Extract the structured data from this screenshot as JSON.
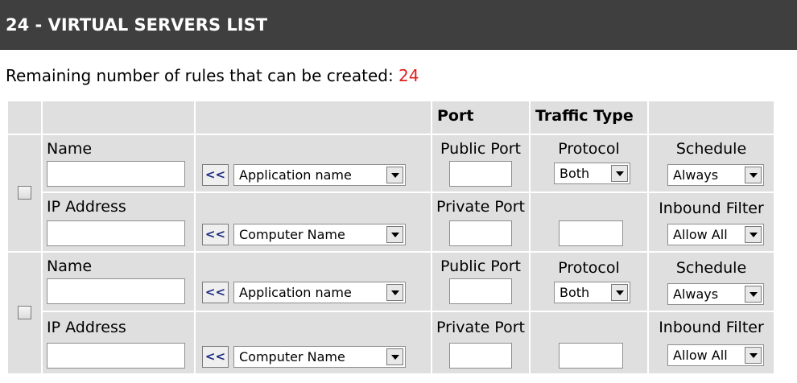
{
  "section": {
    "title": "24 - VIRTUAL SERVERS LIST"
  },
  "remaining": {
    "label": "Remaining number of rules that can be created:",
    "count": "24"
  },
  "table": {
    "headers": {
      "port": "Port",
      "traffic_type": "Traffic Type"
    },
    "rules": [
      {
        "name_label": "Name",
        "name_value": "",
        "app_button": "<<",
        "app_select": "Application name",
        "public_port_label": "Public Port",
        "public_port_value": "",
        "protocol_label": "Protocol",
        "protocol_select": "Both",
        "schedule_label": "Schedule",
        "schedule_select": "Always",
        "ip_label": "IP Address",
        "ip_value": "",
        "computer_button": "<<",
        "computer_select": "Computer Name",
        "private_port_label": "Private Port",
        "private_port_value": "",
        "protocol_number_value": "",
        "inbound_label": "Inbound Filter",
        "inbound_select": "Allow All"
      },
      {
        "name_label": "Name",
        "name_value": "",
        "app_button": "<<",
        "app_select": "Application name",
        "public_port_label": "Public Port",
        "public_port_value": "",
        "protocol_label": "Protocol",
        "protocol_select": "Both",
        "schedule_label": "Schedule",
        "schedule_select": "Always",
        "ip_label": "IP Address",
        "ip_value": "",
        "computer_button": "<<",
        "computer_select": "Computer Name",
        "private_port_label": "Private Port",
        "private_port_value": "",
        "protocol_number_value": "",
        "inbound_label": "Inbound Filter",
        "inbound_select": "Allow All"
      }
    ]
  }
}
